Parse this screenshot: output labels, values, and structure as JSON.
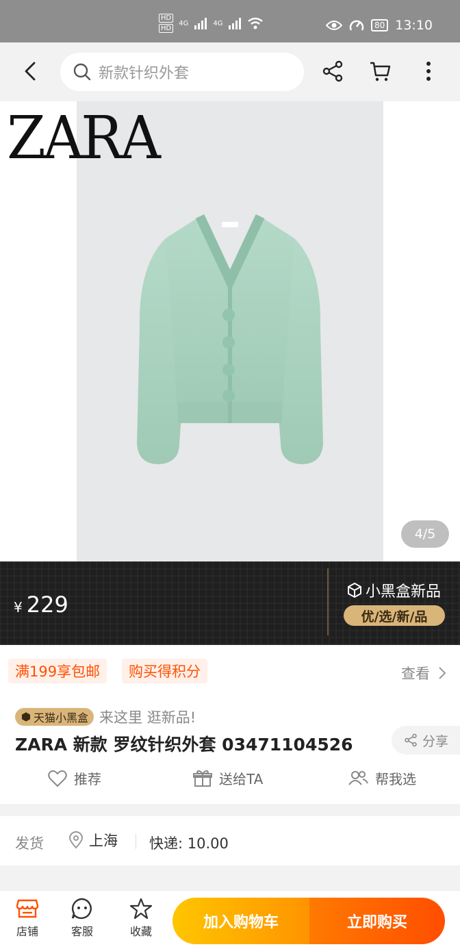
{
  "status_bar": {
    "time": "13:10",
    "battery": "80",
    "sim_labels": [
      "HD",
      "HD"
    ],
    "network": [
      "4G",
      "4G"
    ]
  },
  "top_bar": {
    "search_placeholder": "新款针织外套"
  },
  "gallery": {
    "brand_logo": "ZARA",
    "counter": "4/5",
    "product_color": "#a8d2c0"
  },
  "price_bar": {
    "currency": "¥",
    "price": "229",
    "brand_tag": "小黑盒新品",
    "slogan": "优/选/新/品"
  },
  "promo": {
    "chips": [
      "满199享包邮",
      "购买得积分"
    ],
    "view_more": "查看"
  },
  "product": {
    "badge": "天猫小黑盒",
    "tagline": "来这里 逛新品!",
    "title": "ZARA 新款 罗纹针织外套 03471104526",
    "share": "分享",
    "actions": [
      "推荐",
      "送给TA",
      "帮我选"
    ]
  },
  "shipping": {
    "label": "发货",
    "location": "上海",
    "fee": "快递: 10.00"
  },
  "bottom_bar": {
    "items": [
      "店铺",
      "客服",
      "收藏"
    ],
    "add_to_cart": "加入购物车",
    "buy_now": "立即购买"
  },
  "colors": {
    "accent_orange": "#ff5000",
    "gold": "#d9b57a"
  }
}
